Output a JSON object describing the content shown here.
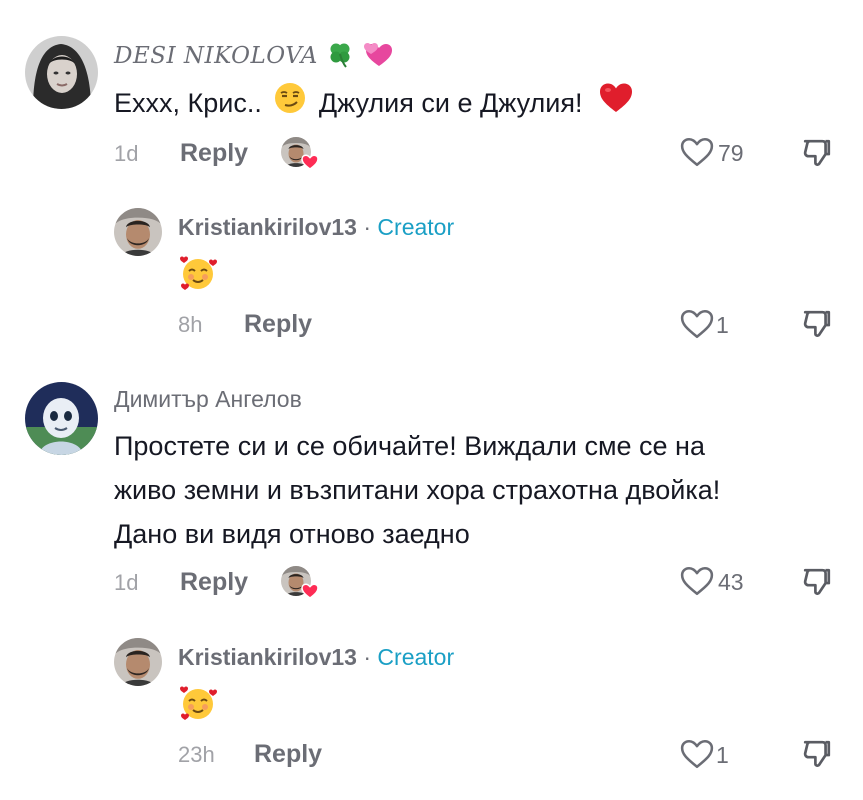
{
  "comments": [
    {
      "username": "DESI NIKOLOVA",
      "text": "Ехxx, Крис..",
      "text_after_emoji": "Джулия си е Джулия!",
      "time": "1d",
      "reply_label": "Reply",
      "likes": "79",
      "icons": [
        "clover-emoji",
        "hearts-emoji",
        "smirk-emoji",
        "red-heart-emoji",
        "creator-liked-avatar",
        "heart-outline-icon",
        "dislike-icon"
      ],
      "reply": {
        "username": "Kristiankirilov13",
        "separator": "·",
        "badge": "Creator",
        "time": "8h",
        "reply_label": "Reply",
        "likes": "1"
      }
    },
    {
      "username": "Димитър Ангелов",
      "text_lines": [
        "Простете си и се обичайте! Виждали сме се на",
        "живо земни и възпитани хора страхотна двойка!",
        "Дано ви видя отново заедно"
      ],
      "time": "1d",
      "reply_label": "Reply",
      "likes": "43",
      "reply": {
        "username": "Kristiankirilov13",
        "separator": "·",
        "badge": "Creator",
        "time": "23h",
        "reply_label": "Reply",
        "likes": "1"
      }
    }
  ],
  "colors": {
    "creator": "#1a9fc5",
    "text": "#161823",
    "muted": "#6b6d75",
    "time": "#a1a2a7",
    "like_badge": "#fe2c55"
  }
}
